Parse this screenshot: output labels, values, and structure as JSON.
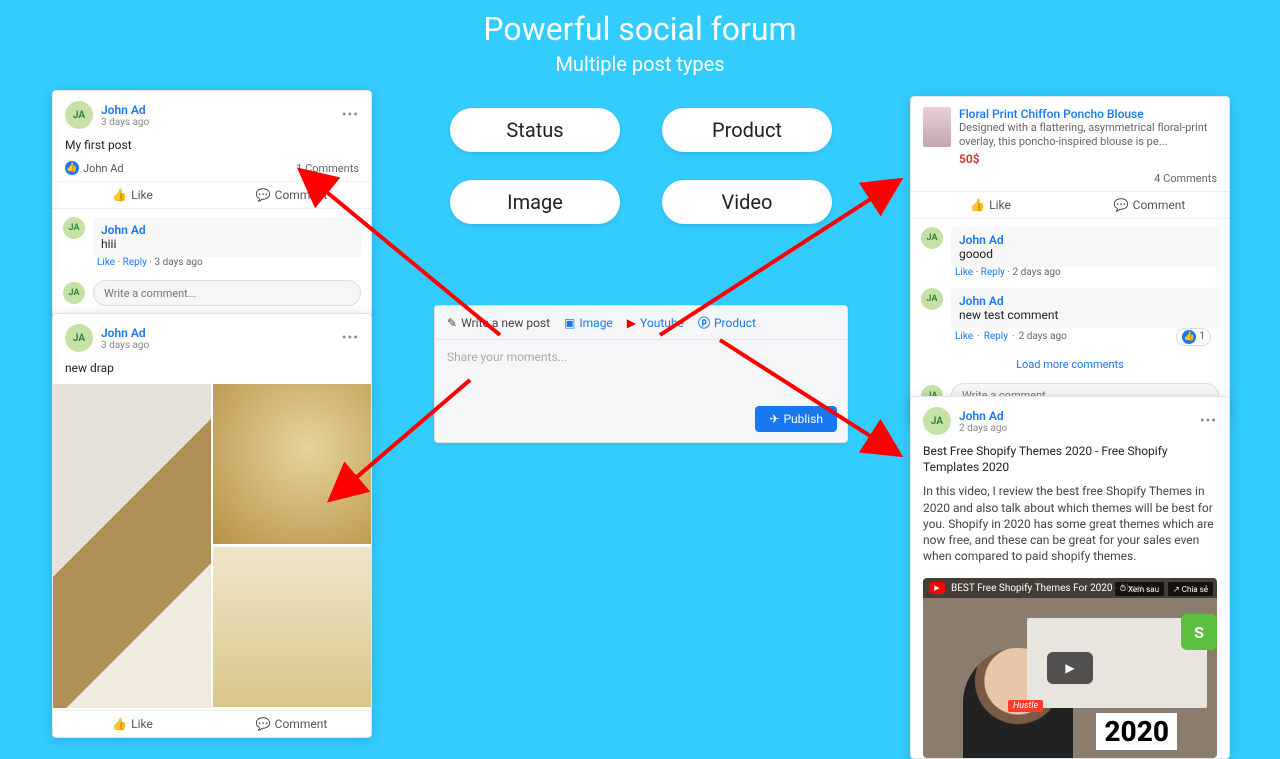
{
  "hero": {
    "title": "Powerful social forum",
    "subtitle": "Multiple post types"
  },
  "pills": {
    "status": "Status",
    "product": "Product",
    "image": "Image",
    "video": "Video"
  },
  "avatar_initials": "JA",
  "composer": {
    "write_tab": "Write a new post",
    "image_tab": "Image",
    "youtube_tab": "Youtube",
    "product_tab": "Product",
    "placeholder": "Share your moments...",
    "publish": "Publish"
  },
  "actions": {
    "like": "Like",
    "comment": "Comment"
  },
  "status_card": {
    "user": "John Ad",
    "time": "3 days ago",
    "body": "My first post",
    "like_summary_user": "John Ad",
    "comments_count": "1 Comments",
    "comment_user": "John Ad",
    "comment_body": "hiii",
    "comment_meta_like": "Like",
    "comment_meta_reply": "Reply",
    "comment_meta_time": "3 days ago",
    "write_placeholder": "Write a comment..."
  },
  "image_card": {
    "user": "John Ad",
    "time": "3 days ago",
    "body": "new drap"
  },
  "product_card": {
    "title": "Floral Print Chiffon Poncho Blouse",
    "desc": "Designed with a flattering, asymmetrical floral-print overlay, this poncho-inspired blouse is pe...",
    "price": "50$",
    "comments_count": "4 Comments",
    "c1_user": "John Ad",
    "c1_body": "goood",
    "c1_time": "2 days ago",
    "c2_user": "John Ad",
    "c2_body": "new test comment",
    "c2_time": "2 days ago",
    "c2_like_count": "1",
    "load_more": "Load more comments",
    "write_placeholder": "Write a comment..."
  },
  "video_card": {
    "user": "John Ad",
    "time": "2 days ago",
    "title_line": "Best Free Shopify Themes 2020 - Free Shopify Templates 2020",
    "body": "In this video, I review the best free Shopify Themes in 2020 and also talk about which themes will be best for you. Shopify in 2020 has some great themes which are now free, and these can be great for your sales even when compared to paid shopify themes.",
    "vid_overlay_title": "BEST Free Shopify Themes For 2020 - Shop...",
    "watch_later": "Xem sau",
    "share": "Chia sẻ",
    "year": "2020",
    "badge": "Hustle"
  },
  "common": {
    "like": "Like",
    "reply": "Reply"
  }
}
